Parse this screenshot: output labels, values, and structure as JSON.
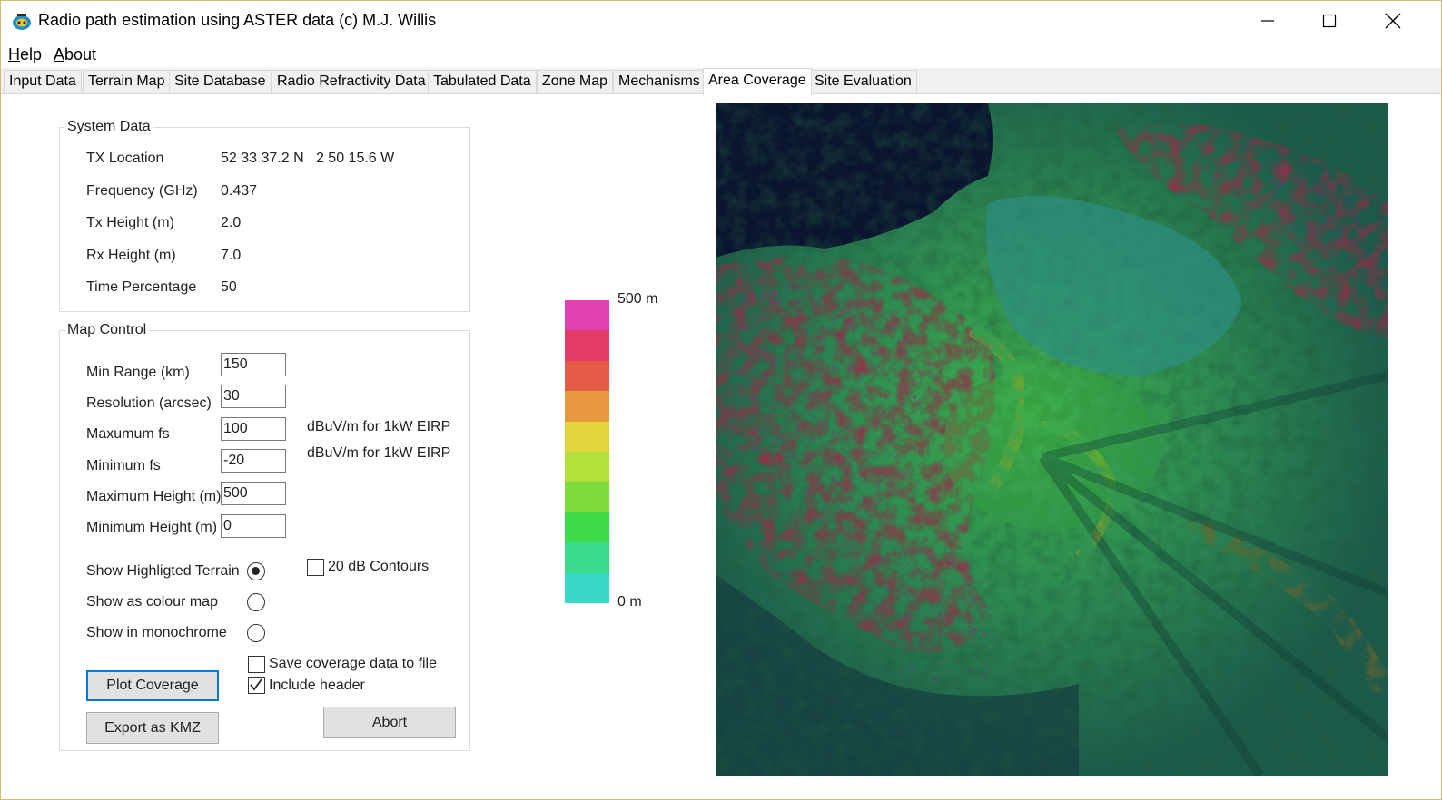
{
  "window": {
    "title": "Radio path estimation using ASTER data (c) M.J. Willis"
  },
  "menu": {
    "help_first": "H",
    "help_rest": "elp",
    "about_first": "A",
    "about_rest": "bout"
  },
  "tabs": [
    {
      "label": "Input Data"
    },
    {
      "label": "Terrain Map"
    },
    {
      "label": "Site Database"
    },
    {
      "label": "Radio Refractivity Data"
    },
    {
      "label": "Tabulated Data"
    },
    {
      "label": "Zone Map"
    },
    {
      "label": "Mechanisms"
    },
    {
      "label": "Area Coverage"
    },
    {
      "label": "Site Evaluation"
    }
  ],
  "system_data": {
    "title": "System Data",
    "rows": [
      {
        "label": "TX Location",
        "value": "52 33 37.2 N   2 50 15.6 W"
      },
      {
        "label": "Frequency (GHz)",
        "value": "0.437"
      },
      {
        "label": "Tx Height (m)",
        "value": "2.0"
      },
      {
        "label": "Rx Height (m)",
        "value": "7.0"
      },
      {
        "label": "Time Percentage",
        "value": "50"
      }
    ]
  },
  "map_control": {
    "title": "Map Control",
    "fields": [
      {
        "label": "Min Range (km)",
        "value": "150"
      },
      {
        "label": "Resolution (arcsec)",
        "value": "30"
      },
      {
        "label": "Maxumum fs",
        "value": "100"
      },
      {
        "label": "Minimum fs",
        "value": "-20"
      },
      {
        "label": "Maximum Height (m)",
        "value": "500"
      },
      {
        "label": "Minimum Height (m)",
        "value": "0"
      }
    ],
    "unit_max_fs": "dBuV/m for 1kW EIRP",
    "unit_min_fs": "dBuV/m for 1kW EIRP",
    "radios": [
      {
        "label": "Show Highligted Terrain",
        "selected": true
      },
      {
        "label": "Show as colour map",
        "selected": false
      },
      {
        "label": "Show in monochrome",
        "selected": false
      }
    ],
    "contours": {
      "label": "20 dB Contours",
      "checked": false
    },
    "save_data": {
      "label": "Save coverage data to file",
      "checked": false
    },
    "include_header": {
      "label": "Include header",
      "checked": true
    },
    "plot_button": "Plot Coverage",
    "export_button": "Export as KMZ",
    "abort_button": "Abort"
  },
  "scale": {
    "top_label": "500 m",
    "bottom_label": "0 m",
    "colors": [
      "#e040b0",
      "#e23c64",
      "#e45c46",
      "#e8983e",
      "#e2d43a",
      "#b4e03c",
      "#7edc3c",
      "#3edc48",
      "#3adc8c",
      "#3ad8c6"
    ]
  }
}
